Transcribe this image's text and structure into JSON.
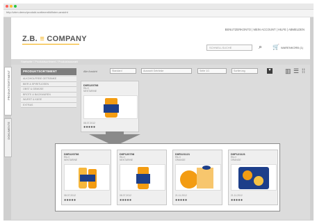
{
  "browser": {
    "url": "http://zbm.demo/produkt-sortiment/#/listen-ansicht",
    "dot_colors": [
      "#ff5f57",
      "#ffbd2e",
      "#28c840"
    ]
  },
  "header": {
    "logo_prefix": "Z.B.",
    "logo_name": "COMPANY",
    "top_links": "BENUTZERKONTO  |  MEIN ACCOUNT  |  HILFE  |  ABMELDEN",
    "search_placeholder": "SCHNELLSUCHE",
    "cart_label": "WARENKORB (1)"
  },
  "breadcrumb": "Startseite / Produktsortiment / Produktauswahl",
  "vertical_tabs": [
    "PRODUKTSORTIMENT",
    "DOKUMENTE"
  ],
  "sidebar": {
    "title": "PRODUKTSORTIMENT",
    "items": [
      "ALKOHOLFREIE GETRÄNKE",
      "BIER & SPIRITUOSEN",
      "OBST & GEMÜSE",
      "BROTE & BACKWAREN",
      "WURST & KÄSE",
      "EXTRAS"
    ]
  },
  "toolbar": {
    "view_label": "Alle Ansicht",
    "view_value": "Standard",
    "filter_value": "Auswahl Getränke",
    "page_value": "Seite 1/1",
    "sort_value": "Sortierung"
  },
  "main_card": {
    "sku": "D0R120708",
    "meta_line1": "RILO",
    "meta_line2": "NEKTARINE",
    "date": "08.07.2012",
    "rating": "●●●●●"
  },
  "zoom_cards": [
    {
      "sku": "D0R120708",
      "meta_line1": "RILO",
      "meta_line2": "NEKTARINE",
      "date": "08.07.2012",
      "rating": "●●●●●"
    },
    {
      "sku": "D0P120708",
      "meta_line1": "RILO",
      "meta_line2": "NEKTARINE",
      "date": "08.07.2012",
      "rating": "●●●●●"
    },
    {
      "sku": "D0R121121",
      "meta_line1": "RILO",
      "meta_line2": "ORANGE",
      "date": "21.11.2012",
      "rating": "●●●●●"
    },
    {
      "sku": "D0P121121",
      "meta_line1": "RILO",
      "meta_line2": "ORANGE",
      "date": "21.11.2012",
      "rating": "●●●●●"
    }
  ],
  "colors": {
    "accent": "#f2a900",
    "dark_panel": "#7d7d7d",
    "product_blue": "#1d3f8a",
    "product_orange": "#f39c12"
  }
}
